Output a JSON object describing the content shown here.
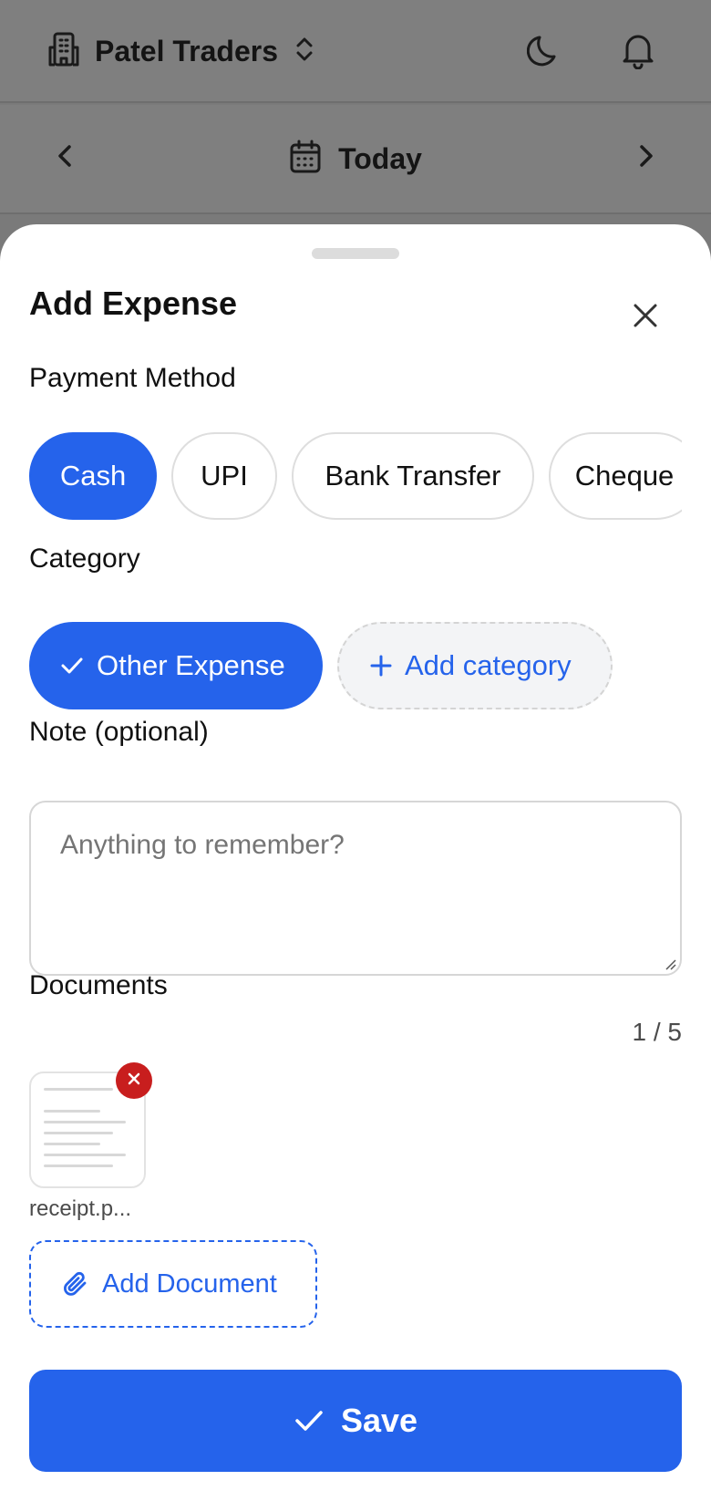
{
  "header": {
    "business_name": "Patel Traders",
    "icons": [
      "building-icon",
      "chevron-up-down-icon",
      "moon-icon",
      "bell-icon"
    ]
  },
  "date_bar": {
    "label": "Today",
    "icons": [
      "chevron-left-icon",
      "calendar-icon",
      "chevron-right-icon"
    ]
  },
  "sheet": {
    "title": "Add Expense",
    "payment_method": {
      "label": "Payment Method",
      "options": [
        "Cash",
        "UPI",
        "Bank Transfer",
        "Cheque"
      ],
      "selected": "Cash"
    },
    "category": {
      "label": "Category",
      "selected_label": "Other Expense",
      "add_label": "Add category"
    },
    "note": {
      "label": "Note (optional)",
      "placeholder": "Anything to remember?",
      "value": ""
    },
    "documents": {
      "label": "Documents",
      "count": "1 / 5",
      "files": [
        {
          "name": "receipt.p..."
        }
      ],
      "add_label": "Add Document"
    },
    "save_label": "Save"
  },
  "colors": {
    "accent": "#2563eb",
    "danger": "#c81e1e",
    "overlay": "#7f7f7f"
  }
}
